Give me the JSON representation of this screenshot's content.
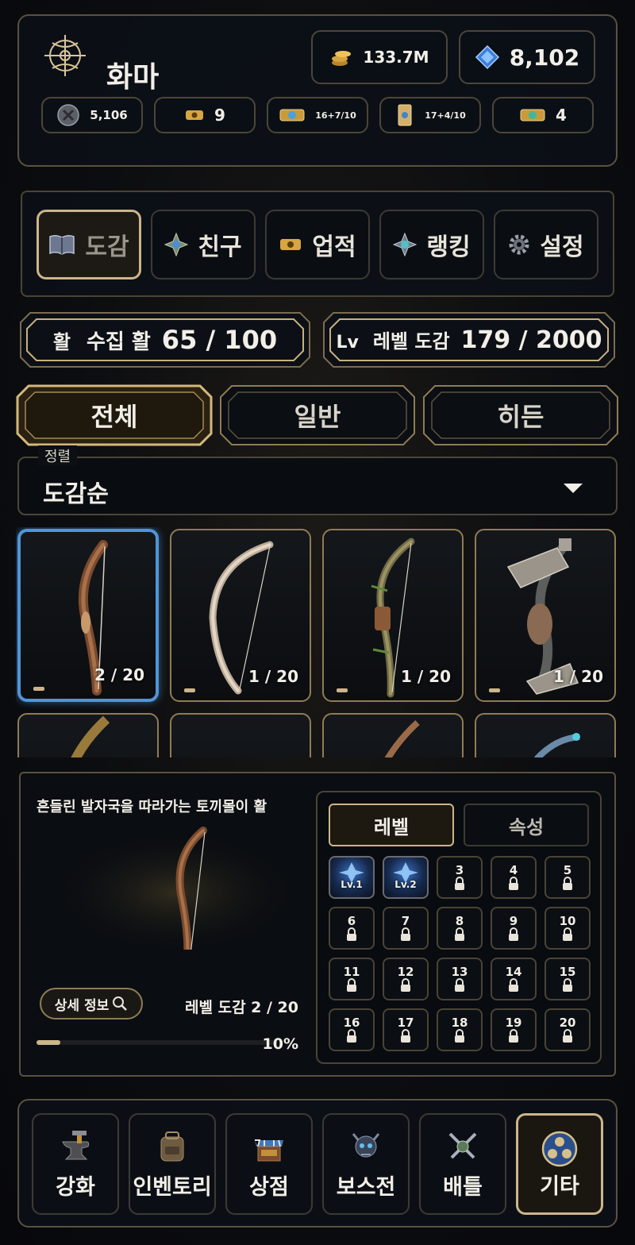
{
  "header": {
    "name": "화마",
    "gold": "133.7M",
    "gems": "8,102",
    "resources": [
      "5,106",
      "9",
      "16+7/10",
      "17+4/10",
      "4"
    ]
  },
  "menu": [
    {
      "label": "도감",
      "icon": "book-icon",
      "active": true
    },
    {
      "label": "친구",
      "icon": "friends-emblem-icon",
      "active": false
    },
    {
      "label": "업적",
      "icon": "ticket-icon",
      "active": false
    },
    {
      "label": "랭킹",
      "icon": "ranking-emblem-icon",
      "active": false
    },
    {
      "label": "설정",
      "icon": "gear-icon",
      "active": false
    }
  ],
  "stats": {
    "collect_icon": "활",
    "collect_label": "수집 활",
    "collect_value": "65 / 100",
    "level_icon": "Lv",
    "level_label": "레벨 도감",
    "level_value": "179 / 2000"
  },
  "filters": [
    {
      "label": "전체",
      "active": true
    },
    {
      "label": "일반",
      "active": false
    },
    {
      "label": "히든",
      "active": false
    }
  ],
  "sort": {
    "legend": "정렬",
    "value": "도감순"
  },
  "bows": [
    {
      "count": "2 / 20",
      "selected": true,
      "style": "carved-wood"
    },
    {
      "count": "1 / 20",
      "selected": false,
      "style": "pale-branch"
    },
    {
      "count": "1 / 20",
      "selected": false,
      "style": "vine-wrapped"
    },
    {
      "count": "1 / 20",
      "selected": false,
      "style": "stone-axe"
    }
  ],
  "detail": {
    "title": "흔들린 발자국을 따라가는 토끼몰이 활",
    "info_button": "상세 정보",
    "level_text": "레벨 도감 2 / 20",
    "percent": "10%",
    "progress": 0.1,
    "tabs": [
      {
        "label": "레벨",
        "active": true
      },
      {
        "label": "속성",
        "active": false
      }
    ],
    "levels": [
      {
        "num": "",
        "unlocked": "Lv.1"
      },
      {
        "num": "",
        "unlocked": "Lv.2"
      },
      {
        "num": "3"
      },
      {
        "num": "4"
      },
      {
        "num": "5"
      },
      {
        "num": "6"
      },
      {
        "num": "7"
      },
      {
        "num": "8"
      },
      {
        "num": "9"
      },
      {
        "num": "10"
      },
      {
        "num": "11"
      },
      {
        "num": "12"
      },
      {
        "num": "13"
      },
      {
        "num": "14"
      },
      {
        "num": "15"
      },
      {
        "num": "16"
      },
      {
        "num": "17"
      },
      {
        "num": "18"
      },
      {
        "num": "19"
      },
      {
        "num": "20"
      }
    ]
  },
  "nav": [
    {
      "label": "강화",
      "icon": "anvil-icon",
      "active": false
    },
    {
      "label": "인벤토리",
      "icon": "backpack-icon",
      "active": false
    },
    {
      "label": "상점",
      "icon": "shop-icon",
      "active": false
    },
    {
      "label": "보스전",
      "icon": "boss-skull-icon",
      "active": false
    },
    {
      "label": "배틀",
      "icon": "crossed-swords-icon",
      "active": false
    },
    {
      "label": "기타",
      "icon": "more-emblem-icon",
      "active": true
    }
  ],
  "colors": {
    "gold": "#cdb58a",
    "selection": "#4f95d8",
    "background": "#0c0d10"
  }
}
